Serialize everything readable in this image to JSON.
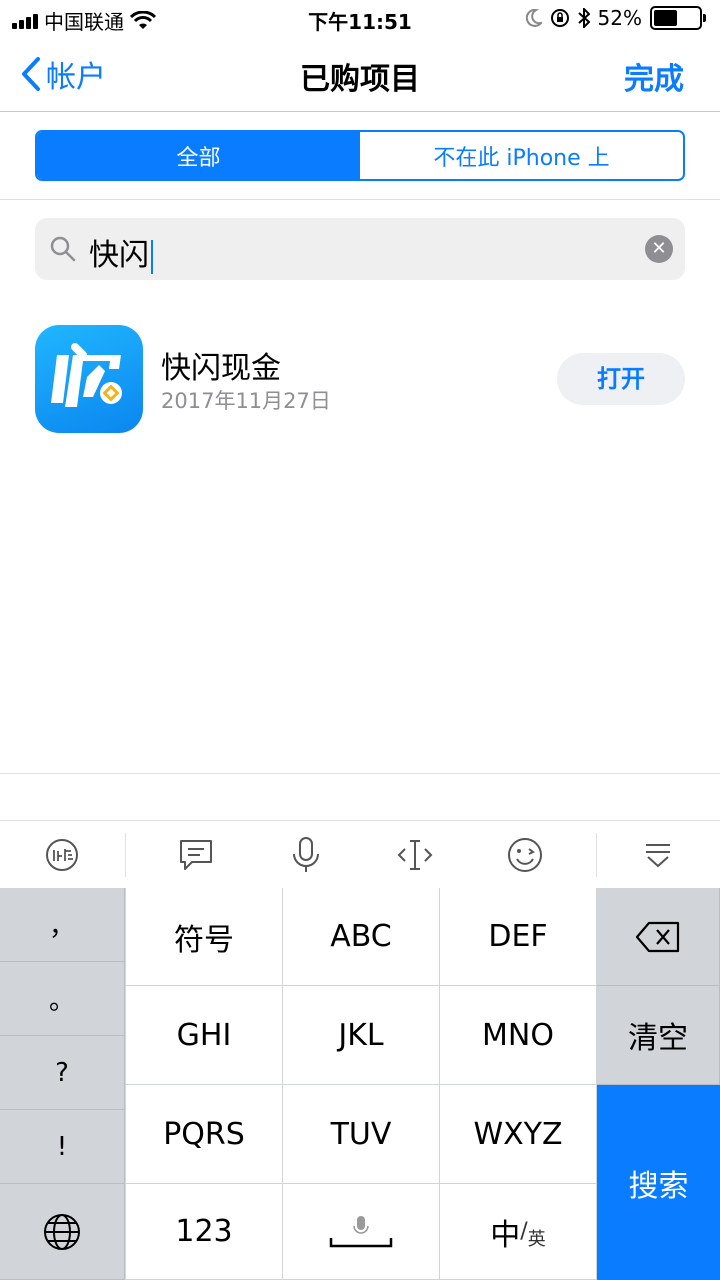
{
  "status": {
    "carrier": "中国联通",
    "time": "下午11:51",
    "battery": "52%",
    "battery_level": 0.52
  },
  "nav": {
    "back_label": "帐户",
    "title": "已购项目",
    "done_label": "完成"
  },
  "segments": [
    "全部",
    "不在此 iPhone 上"
  ],
  "search": {
    "value": "快闪"
  },
  "app": {
    "name": "快闪现金",
    "date": "2017年11月27日",
    "action": "打开"
  },
  "keyboard": {
    "left_column": [
      "，",
      "。",
      "?",
      "!"
    ],
    "rows": [
      [
        "符号",
        "ABC",
        "DEF"
      ],
      [
        "GHI",
        "JKL",
        "MNO"
      ],
      [
        "PQRS",
        "TUV",
        "WXYZ"
      ],
      [
        "123",
        "",
        "中/英"
      ]
    ],
    "clear_label": "清空",
    "search_label": "搜索",
    "lang_main": "中",
    "lang_sub": "英"
  },
  "colors": {
    "accent": "#0a7cff",
    "icon_gradient_top": "#21b6ff",
    "icon_gradient_bottom": "#0a86ef"
  }
}
